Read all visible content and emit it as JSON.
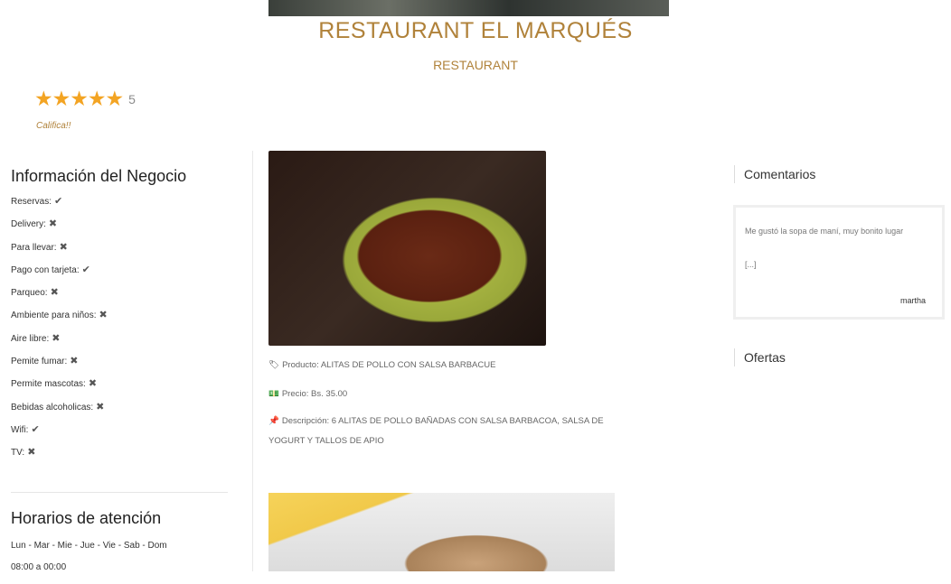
{
  "header": {
    "title": "RESTAURANT EL MARQUÉS",
    "subtitle": "RESTAURANT"
  },
  "rating": {
    "stars": "★★★★★",
    "value": "5",
    "action": "Califica!!",
    "stars_filled": 5,
    "stars_total": 5
  },
  "business_info": {
    "title": "Información del Negocio",
    "items": [
      {
        "label": "Reservas:",
        "mark": "✔"
      },
      {
        "label": "Delivery:",
        "mark": "✖"
      },
      {
        "label": "Para llevar:",
        "mark": "✖"
      },
      {
        "label": "Pago con tarjeta:",
        "mark": "✔"
      },
      {
        "label": "Parqueo:",
        "mark": "✖"
      },
      {
        "label": "Ambiente para niños:",
        "mark": "✖"
      },
      {
        "label": "Aire libre:",
        "mark": "✖"
      },
      {
        "label": "Pemite fumar:",
        "mark": "✖"
      },
      {
        "label": "Permite mascotas:",
        "mark": "✖"
      },
      {
        "label": "Bebidas alcoholicas:",
        "mark": "✖"
      },
      {
        "label": "Wifi:",
        "mark": "✔"
      },
      {
        "label": "TV:",
        "mark": "✖"
      }
    ]
  },
  "hours": {
    "title": "Horarios de atención",
    "days": "Lun - Mar - Mie - Jue - Vie - Sab - Dom",
    "time": "08:00 a 00:00"
  },
  "product": {
    "product_line": "Producto: ALITAS DE POLLO CON SALSA BARBACUE",
    "price_line": "Precio: Bs. 35.00",
    "description_line_1": "Descripción: 6 ALITAS DE POLLO BAÑADAS CON SALSA BARBACOA, SALSA DE",
    "description_line_2": "YOGURT Y TALLOS DE APIO",
    "icons": {
      "product": "tag-icon",
      "price": "money-icon",
      "description": "pin-icon"
    }
  },
  "comments": {
    "title": "Comentarios",
    "text": "Me gustó la sopa de maní, muy bonito lugar",
    "more": "[...]",
    "author": "martha"
  },
  "offers": {
    "title": "Ofertas"
  }
}
